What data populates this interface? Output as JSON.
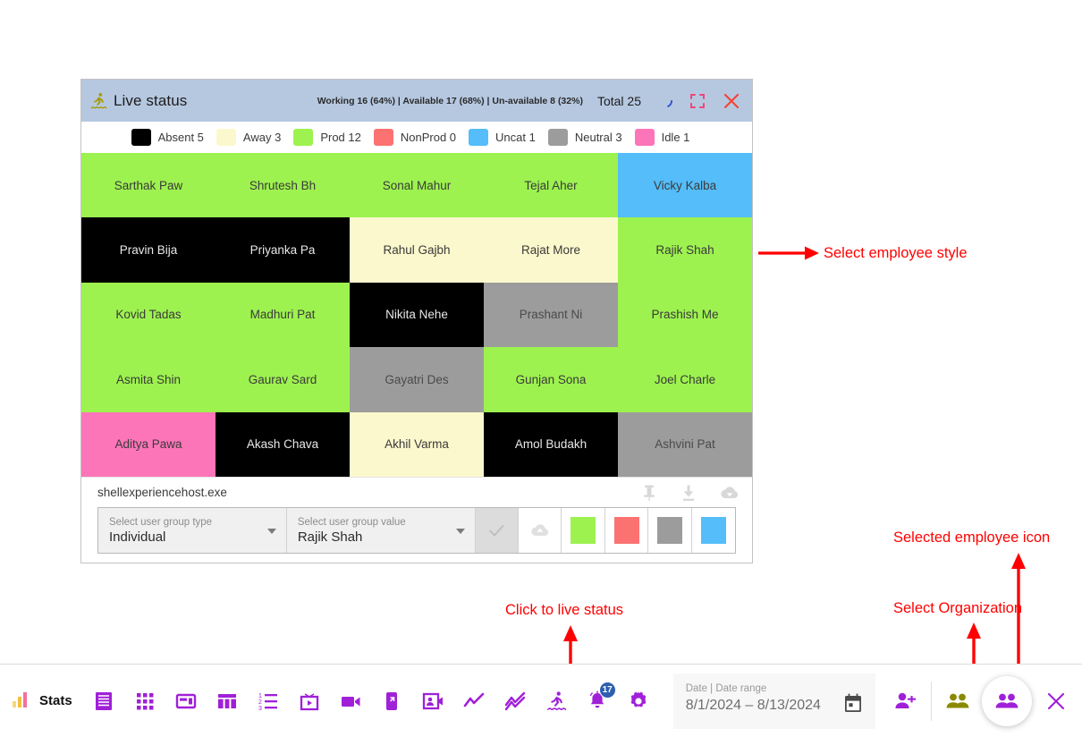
{
  "panel": {
    "app_icon": "surfer-icon",
    "title": "Live status",
    "stats_line": "Working 16 (64%) |  Available 17 (68%) |  Un-available 8 (32%)",
    "total_label": "Total 25",
    "refresh_icon": "loading-spinner-icon",
    "fullscreen_icon": "fullscreen-icon",
    "close_icon": "close-icon"
  },
  "legend": [
    {
      "label": "Absent 5",
      "color": "#000000"
    },
    {
      "label": "Away 3",
      "color": "#fbf8cd"
    },
    {
      "label": "Prod 12",
      "color": "#9df24f"
    },
    {
      "label": "NonProd 0",
      "color": "#fc7272"
    },
    {
      "label": "Uncat 1",
      "color": "#54bdfa"
    },
    {
      "label": "Neutral 3",
      "color": "#9c9c9c"
    },
    {
      "label": "Idle 1",
      "color": "#fc75b8"
    }
  ],
  "grid": {
    "columns": 5,
    "cells": [
      {
        "name": "Sarthak Paw",
        "color": "#9df24f",
        "text": "#3a3a3a"
      },
      {
        "name": "Shrutesh Bh",
        "color": "#9df24f",
        "text": "#3a3a3a"
      },
      {
        "name": "Sonal Mahur",
        "color": "#9df24f",
        "text": "#3a3a3a"
      },
      {
        "name": "Tejal Aher",
        "color": "#9df24f",
        "text": "#3a3a3a"
      },
      {
        "name": "Vicky Kalba",
        "color": "#54bdfa",
        "text": "#3a3a3a"
      },
      {
        "name": "Pravin Bija",
        "color": "#000000",
        "text": "#e8e8e8"
      },
      {
        "name": "Priyanka Pa",
        "color": "#000000",
        "text": "#e8e8e8"
      },
      {
        "name": "Rahul Gajbh",
        "color": "#fbf8cd",
        "text": "#3a3a3a"
      },
      {
        "name": "Rajat More",
        "color": "#fbf8cd",
        "text": "#3a3a3a"
      },
      {
        "name": "Rajik Shah",
        "color": "#9df24f",
        "text": "#3a3a3a"
      },
      {
        "name": "Kovid Tadas",
        "color": "#9df24f",
        "text": "#3a3a3a"
      },
      {
        "name": "Madhuri Pat",
        "color": "#9df24f",
        "text": "#3a3a3a"
      },
      {
        "name": "Nikita Nehe",
        "color": "#000000",
        "text": "#e8e8e8"
      },
      {
        "name": "Prashant Ni",
        "color": "#9c9c9c",
        "text": "#4a4a4a"
      },
      {
        "name": "Prashish Me",
        "color": "#9df24f",
        "text": "#3a3a3a"
      },
      {
        "name": "Asmita Shin",
        "color": "#9df24f",
        "text": "#3a3a3a"
      },
      {
        "name": "Gaurav Sard",
        "color": "#9df24f",
        "text": "#3a3a3a"
      },
      {
        "name": "Gayatri Des",
        "color": "#9c9c9c",
        "text": "#4a4a4a"
      },
      {
        "name": "Gunjan Sona",
        "color": "#9df24f",
        "text": "#3a3a3a"
      },
      {
        "name": "Joel Charle",
        "color": "#9df24f",
        "text": "#3a3a3a"
      },
      {
        "name": "Aditya Pawa",
        "color": "#fc75b8",
        "text": "#3a3a3a"
      },
      {
        "name": "Akash Chava",
        "color": "#000000",
        "text": "#e8e8e8"
      },
      {
        "name": "Akhil Varma",
        "color": "#fbf8cd",
        "text": "#3a3a3a"
      },
      {
        "name": "Amol Budakh",
        "color": "#000000",
        "text": "#e8e8e8"
      },
      {
        "name": "Ashvini Pat",
        "color": "#9c9c9c",
        "text": "#4a4a4a"
      }
    ]
  },
  "process": {
    "name": "shellexperiencehost.exe",
    "actions": [
      {
        "icon": "pin-icon"
      },
      {
        "icon": "download-icon"
      },
      {
        "icon": "cloud-download-icon"
      }
    ]
  },
  "form": {
    "group_type": {
      "label": "Select user group type",
      "value": "Individual"
    },
    "group_value": {
      "label": "Select user group value",
      "value": "Rajik Shah"
    },
    "check_icon": "check-icon",
    "cloud_icon": "cloud-upload-icon",
    "colors": [
      {
        "name": "productive-color",
        "color": "#9df24f"
      },
      {
        "name": "nonproductive-color",
        "color": "#fc7272"
      },
      {
        "name": "neutral-color",
        "color": "#9c9c9c"
      },
      {
        "name": "uncategorized-color",
        "color": "#54bdfa"
      }
    ]
  },
  "annotations": {
    "select_employee_style": "Select employee style",
    "selected_employee_icon": "Selected employee icon",
    "select_organization": "Select Organization",
    "click_to_live_status": "Click to live status",
    "color": "#ff0000"
  },
  "taskbar": {
    "logo_label": "Stats",
    "logo_icon": "bar-chart-logo-icon",
    "icons": [
      {
        "name": "document-icon"
      },
      {
        "name": "apps-grid-icon"
      },
      {
        "name": "card-layout-icon"
      },
      {
        "name": "columns-chart-icon"
      },
      {
        "name": "ordered-list-icon"
      },
      {
        "name": "media-player-icon"
      },
      {
        "name": "video-camera-icon"
      },
      {
        "name": "mobile-device-icon"
      },
      {
        "name": "contact-video-icon"
      },
      {
        "name": "line-chart-icon"
      },
      {
        "name": "trend-chart-icon"
      },
      {
        "name": "live-status-surfer-icon"
      },
      {
        "name": "notification-bell-icon",
        "badge": "17"
      },
      {
        "name": "settings-gear-icon"
      }
    ],
    "date": {
      "label": "Date | Date range",
      "value": "8/1/2024 – 8/13/2024",
      "calendar_icon": "calendar-icon"
    },
    "right_icons": [
      {
        "name": "add-user-icon"
      },
      {
        "name": "organization-group-icon"
      }
    ],
    "selected_employee_icon": "selected-employee-group-icon",
    "close_icon": "close-icon"
  }
}
